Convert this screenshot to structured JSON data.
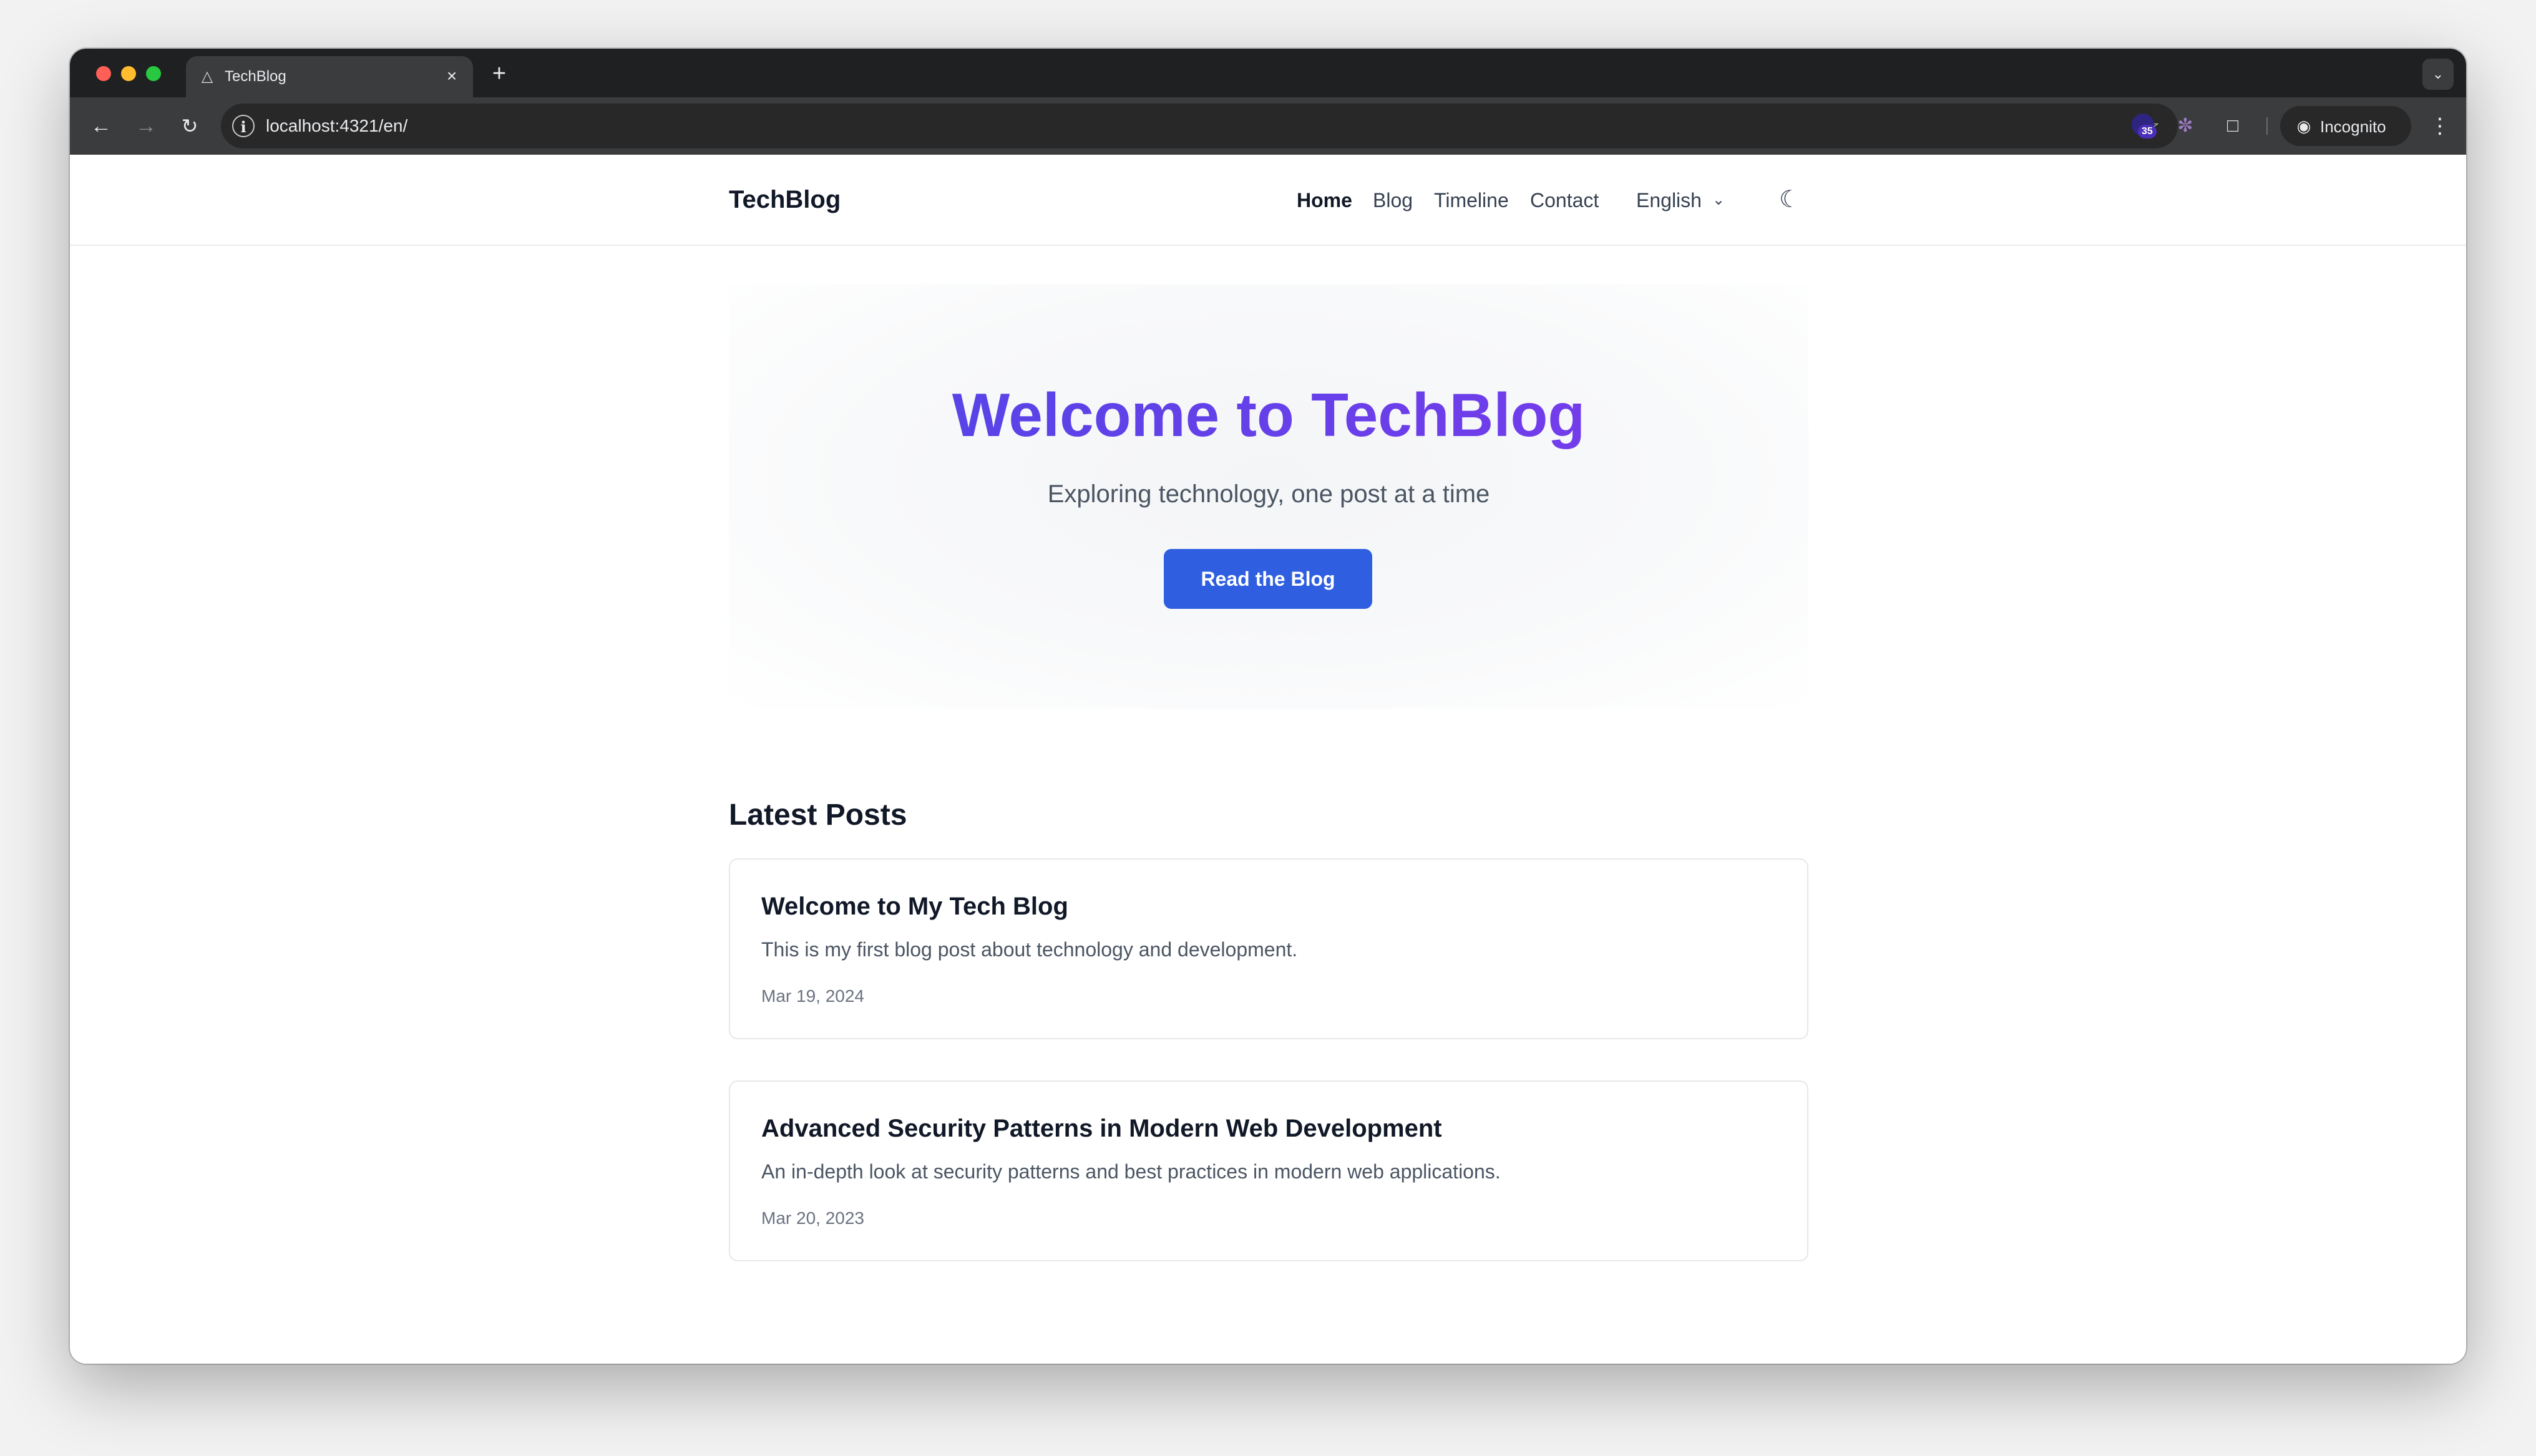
{
  "browser": {
    "tab_title": "TechBlog",
    "url": "localhost:4321/en/",
    "extension_badge": "35",
    "incognito_label": "Incognito",
    "icons": {
      "back": "arrow-left-icon",
      "forward": "arrow-right-icon",
      "reload": "reload-icon",
      "site_info": "info-icon",
      "bookmark": "star-icon",
      "extensions": "puzzle-icon",
      "menu": "kebab-menu-icon",
      "tab_search": "chevron-down-icon"
    }
  },
  "site": {
    "brand": "TechBlog",
    "nav": {
      "home": "Home",
      "blog": "Blog",
      "timeline": "Timeline",
      "contact": "Contact"
    },
    "language": "English",
    "theme_toggle_icon": "moon-icon"
  },
  "hero": {
    "title": "Welcome to TechBlog",
    "subtitle": "Exploring technology, one post at a time",
    "cta_label": "Read the Blog",
    "title_gradient": [
      "#4f46e5",
      "#7c3aed"
    ],
    "cta_color": "#2f5fe0"
  },
  "latest": {
    "heading": "Latest Posts",
    "posts": [
      {
        "title": "Welcome to My Tech Blog",
        "description": "This is my first blog post about technology and development.",
        "date": "Mar 19, 2024"
      },
      {
        "title": "Advanced Security Patterns in Modern Web Development",
        "description": "An in-depth look at security patterns and best practices in modern web applications.",
        "date": "Mar 20, 2023"
      }
    ]
  }
}
